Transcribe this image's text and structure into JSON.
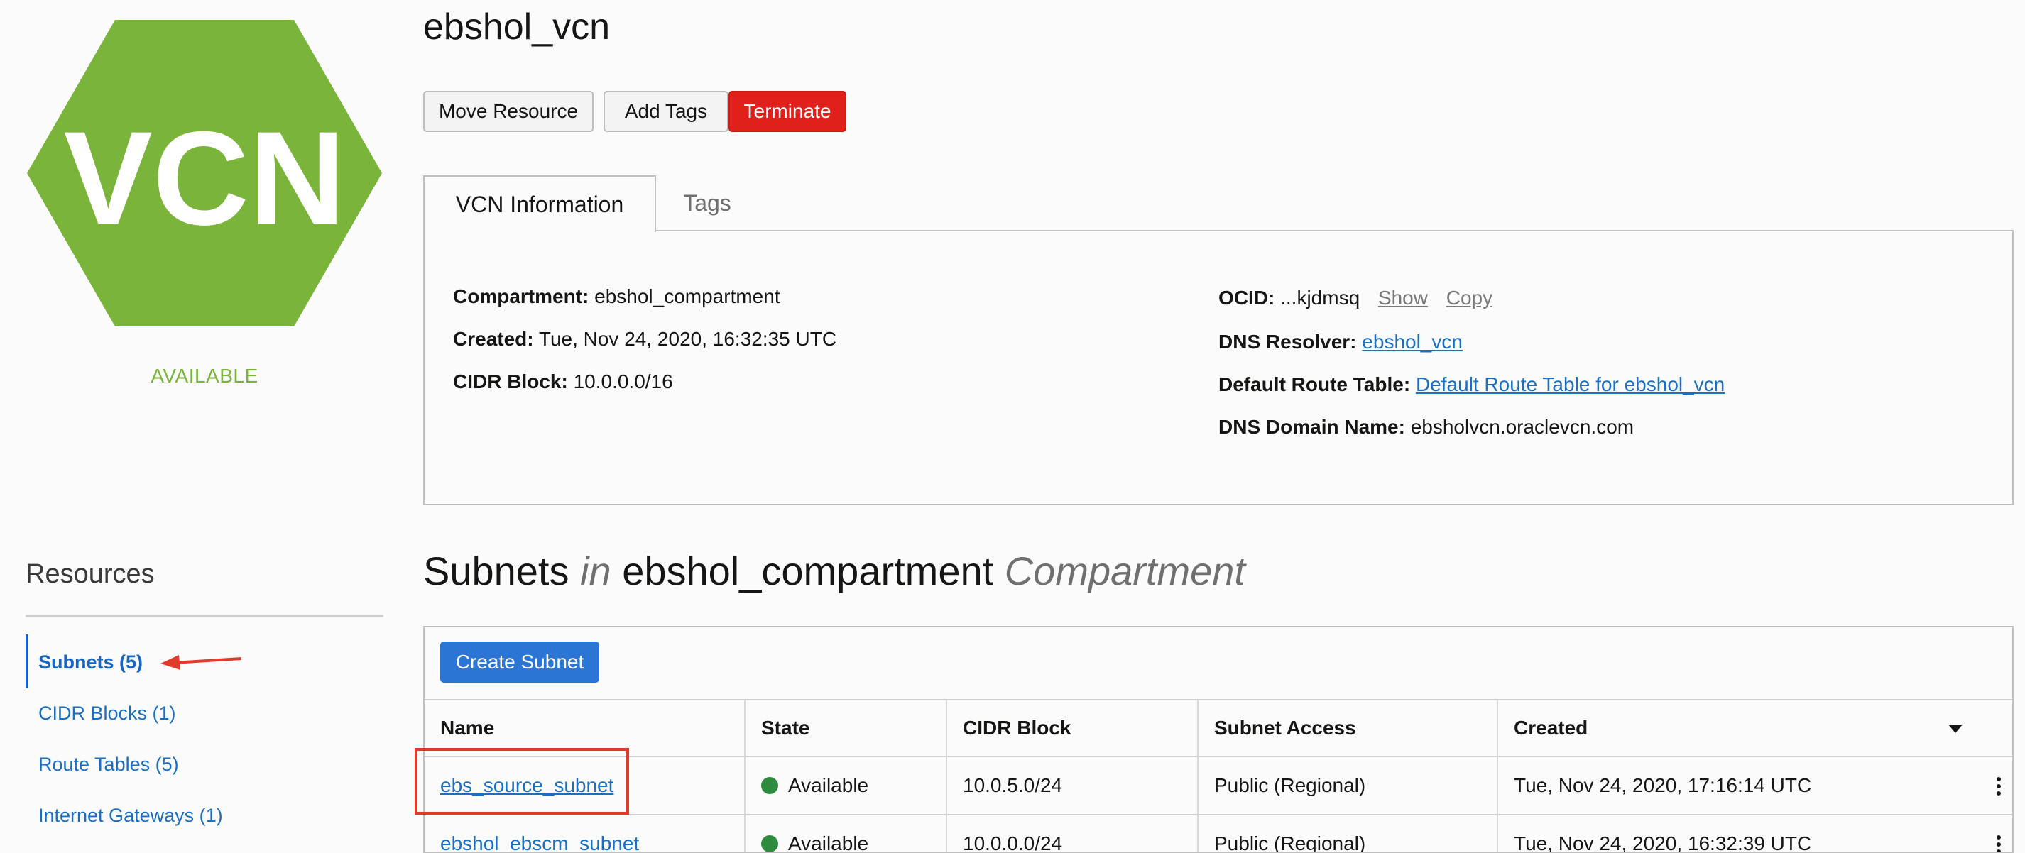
{
  "resource": {
    "icon_text": "VCN",
    "status": "AVAILABLE",
    "title": "ebshol_vcn",
    "colors": {
      "hexagon": "#7ab43a",
      "status": "#7ab43a",
      "danger": "#e0211b",
      "primary": "#2b76d4",
      "link": "#1a6fc4"
    }
  },
  "actions": {
    "move_resource": "Move Resource",
    "add_tags": "Add Tags",
    "terminate": "Terminate"
  },
  "tabs": [
    {
      "label": "VCN Information",
      "active": true
    },
    {
      "label": "Tags",
      "active": false
    }
  ],
  "info": {
    "compartment_label": "Compartment:",
    "compartment_value": "ebshol_compartment",
    "created_label": "Created:",
    "created_value": "Tue, Nov 24, 2020, 16:32:35 UTC",
    "cidr_label": "CIDR Block:",
    "cidr_value": "10.0.0.0/16",
    "ocid_label": "OCID:",
    "ocid_value": "...kjdmsq",
    "ocid_show": "Show",
    "ocid_copy": "Copy",
    "dns_resolver_label": "DNS Resolver:",
    "dns_resolver_value": "ebshol_vcn",
    "route_table_label": "Default Route Table:",
    "route_table_value": "Default Route Table for ebshol_vcn",
    "dns_domain_label": "DNS Domain Name:",
    "dns_domain_value": "ebsholvcn.oraclevcn.com"
  },
  "resources": {
    "title": "Resources",
    "items": [
      {
        "label": "Subnets (5)",
        "active": true
      },
      {
        "label": "CIDR Blocks (1)",
        "active": false
      },
      {
        "label": "Route Tables (5)",
        "active": false
      },
      {
        "label": "Internet Gateways (1)",
        "active": false
      }
    ]
  },
  "subnets": {
    "title_prefix": "Subnets",
    "title_in": "in",
    "title_compartment": "ebshol_compartment",
    "title_suffix": "Compartment",
    "create_button": "Create Subnet",
    "columns": [
      "Name",
      "State",
      "CIDR Block",
      "Subnet Access",
      "Created"
    ],
    "rows": [
      {
        "name": "ebs_source_subnet",
        "state": "Available",
        "cidr": "10.0.5.0/24",
        "access": "Public (Regional)",
        "created": "Tue, Nov 24, 2020, 17:16:14 UTC"
      },
      {
        "name": "ebshol_ebscm_subnet",
        "state": "Available",
        "cidr": "10.0.0.0/24",
        "access": "Public (Regional)",
        "created": "Tue, Nov 24, 2020, 16:32:39 UTC"
      }
    ]
  }
}
